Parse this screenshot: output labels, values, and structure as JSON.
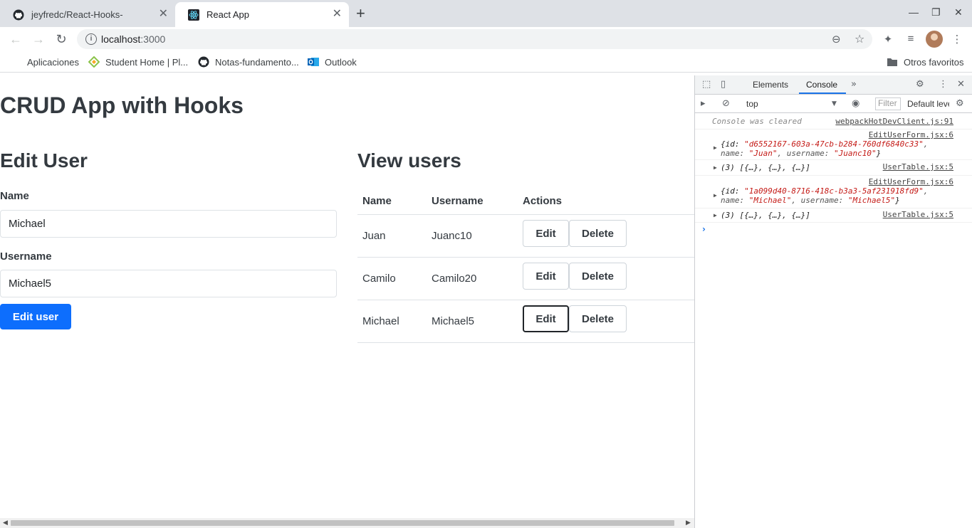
{
  "browser": {
    "tabs": [
      {
        "title": "jeyfredc/React-Hooks-",
        "active": false
      },
      {
        "title": "React App",
        "active": true
      }
    ],
    "url_host": "localhost",
    "url_port": ":3000",
    "bookmarks": [
      {
        "label": "Aplicaciones",
        "icon": "apps-grid-icon"
      },
      {
        "label": "Student Home | Pl...",
        "icon": "student-home-icon"
      },
      {
        "label": "Notas-fundamento...",
        "icon": "github-icon"
      },
      {
        "label": "Outlook",
        "icon": "outlook-icon"
      }
    ],
    "other_bookmarks": "Otros favoritos",
    "icons": {
      "back": "←",
      "forward": "→",
      "reload": "↻",
      "close": "✕",
      "new_tab": "+",
      "minimize": "—",
      "maximize": "❐",
      "star": "☆",
      "zoom": "⊖",
      "extensions": "✦",
      "media": "≡",
      "menu": "⋮",
      "info": "i",
      "folder": "▬"
    }
  },
  "app": {
    "title": "CRUD App with Hooks",
    "edit_section": {
      "heading": "Edit User",
      "name_label": "Name",
      "name_value": "Michael",
      "username_label": "Username",
      "username_value": "Michael5",
      "submit_label": "Edit user"
    },
    "view_section": {
      "heading": "View users",
      "columns": [
        "Name",
        "Username",
        "Actions"
      ],
      "rows": [
        {
          "name": "Juan",
          "username": "Juanc10"
        },
        {
          "name": "Camilo",
          "username": "Camilo20"
        },
        {
          "name": "Michael",
          "username": "Michael5"
        }
      ],
      "edit_label": "Edit",
      "delete_label": "Delete"
    }
  },
  "devtools": {
    "tabs": [
      "Elements",
      "Console"
    ],
    "active_tab": "Console",
    "more_tabs": "»",
    "context": "top",
    "filter_placeholder": "Filter",
    "levels": "Default levels",
    "icons": {
      "inspect": "⬚",
      "device": "▯",
      "settings": "⚙",
      "more": "⋮",
      "close": "✕",
      "sidebar": "▸",
      "clear": "⊘",
      "dropdown": "▼",
      "eye": "◉",
      "expand": "▶",
      "prompt": "›"
    },
    "console": {
      "cleared": {
        "message": "Console was cleared",
        "source": "webpackHotDevClient.js:91"
      },
      "log1": {
        "source": "EditUserForm.jsx:6",
        "open": "{id: ",
        "id": "\"d6552167-603a-47cb-b284-760df6840c33\"",
        "name_key": ", name:",
        "name": "\"Juan\"",
        "username_key": ", username: ",
        "username": "\"Juanc10\"",
        "close": "}"
      },
      "array1": {
        "text": "(3) [{…}, {…}, {…}]",
        "source": "UserTable.jsx:5"
      },
      "log2": {
        "source": "EditUserForm.jsx:6",
        "open": "{id: ",
        "id": "\"1a099d40-8716-418c-b3a3-5af231918fd9\"",
        "name_key": ", name:",
        "name": "\"Michael\"",
        "username_key": ", username: ",
        "username": "\"Michael5\"",
        "close": "}"
      },
      "array2": {
        "text": "(3) [{…}, {…}, {…}]",
        "source": "UserTable.jsx:5"
      }
    }
  }
}
